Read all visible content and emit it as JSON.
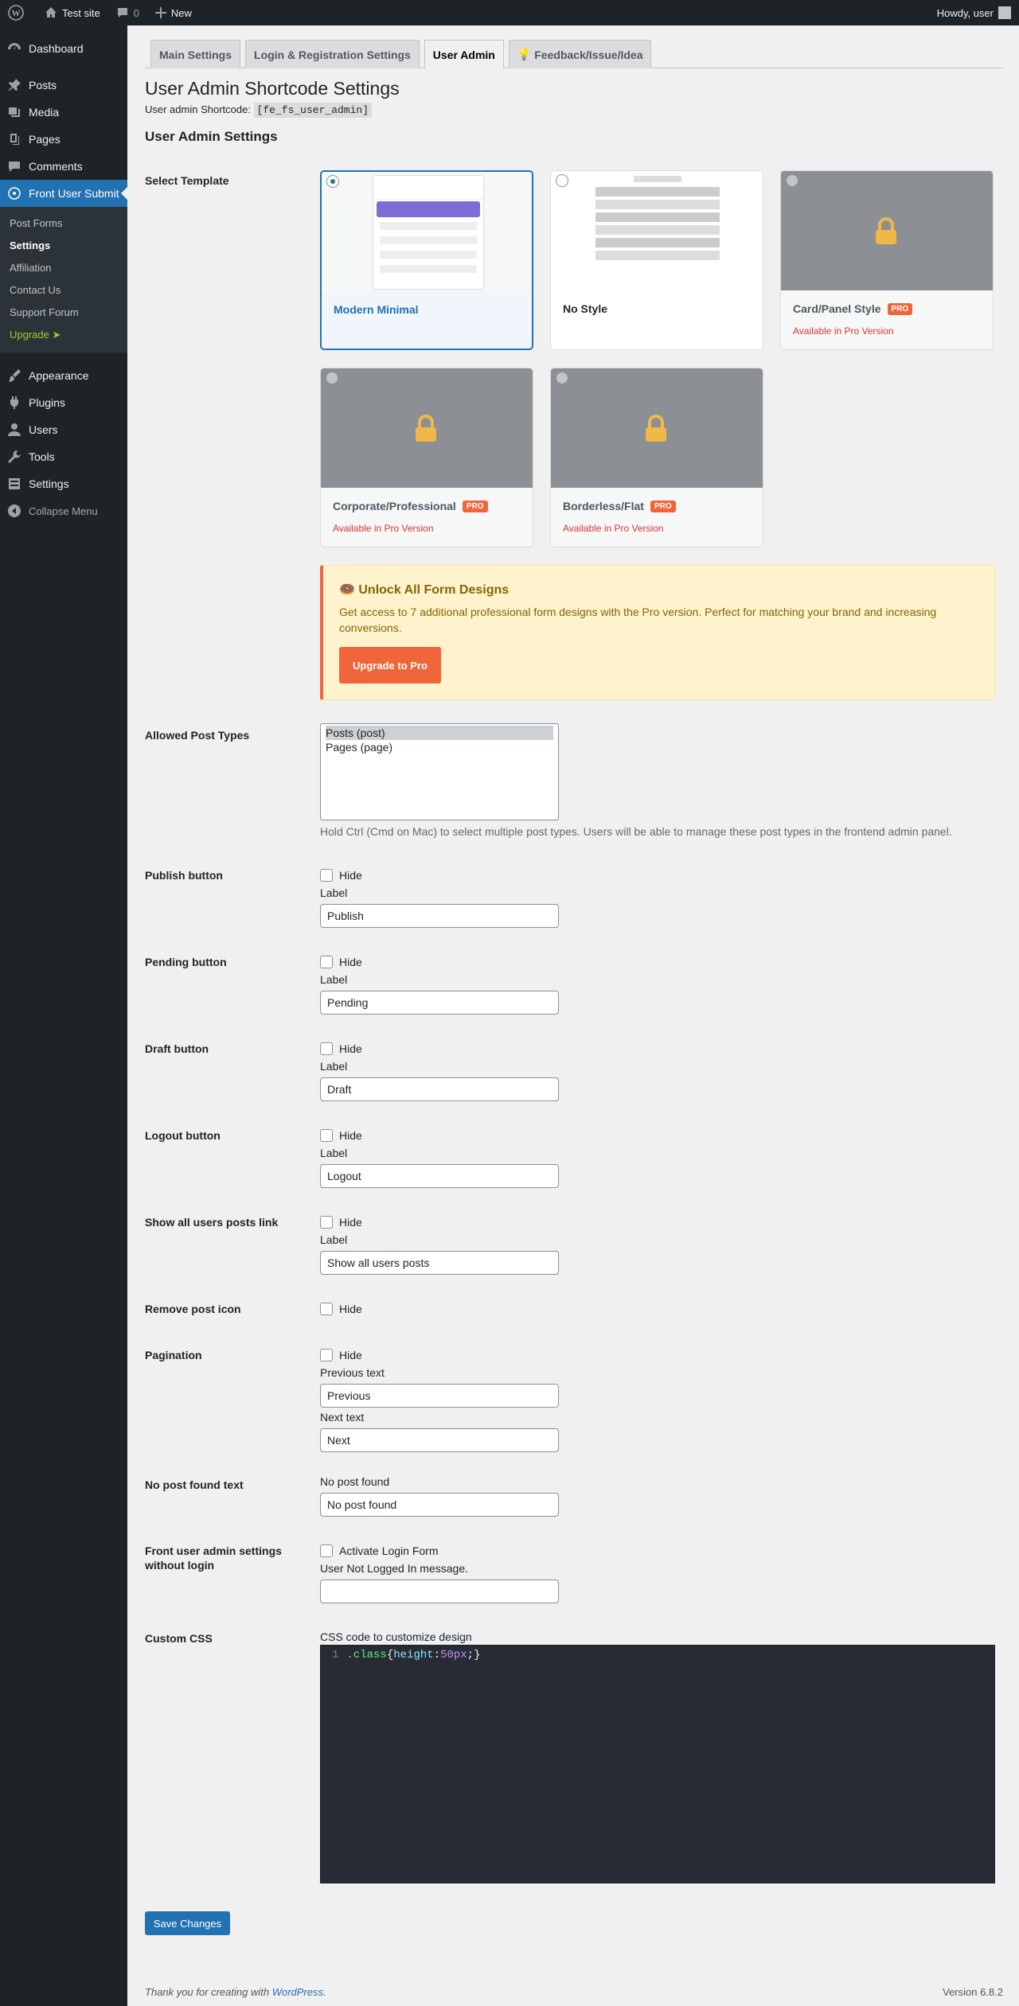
{
  "adminbar": {
    "site": "Test site",
    "comments": "0",
    "new": "New",
    "howdy": "Howdy, user"
  },
  "menu": {
    "items": [
      {
        "label": "Dashboard",
        "icon": "dashboard-icon"
      },
      {
        "label": "Posts",
        "icon": "pin-icon"
      },
      {
        "label": "Media",
        "icon": "media-icon"
      },
      {
        "label": "Pages",
        "icon": "pages-icon"
      },
      {
        "label": "Comments",
        "icon": "comment-icon"
      },
      {
        "label": "Front User Submit",
        "icon": "front-user-submit-icon"
      }
    ],
    "submenu": [
      "Post Forms",
      "Settings",
      "Affiliation",
      "Contact Us",
      "Support Forum",
      "Upgrade ➤"
    ],
    "items2": [
      {
        "label": "Appearance",
        "icon": "brush-icon"
      },
      {
        "label": "Plugins",
        "icon": "plug-icon"
      },
      {
        "label": "Users",
        "icon": "user-icon"
      },
      {
        "label": "Tools",
        "icon": "wrench-icon"
      },
      {
        "label": "Settings",
        "icon": "settings-icon"
      }
    ],
    "collapse": "Collapse Menu"
  },
  "tabs": [
    "Main Settings",
    "Login & Registration Settings",
    "User Admin",
    "Feedback/Issue/Idea"
  ],
  "page": {
    "title": "User Admin Shortcode Settings",
    "shortcode_label": "User admin Shortcode:",
    "shortcode": "[fe_fs_user_admin]",
    "section": "User Admin Settings"
  },
  "template": {
    "label": "Select Template",
    "cards": [
      {
        "name": "Modern Minimal"
      },
      {
        "name": "No Style"
      },
      {
        "name": "Card/Panel Style",
        "pro": "PRO",
        "note": "Available in Pro Version"
      },
      {
        "name": "Corporate/Professional",
        "pro": "PRO",
        "note": "Available in Pro Version"
      },
      {
        "name": "Borderless/Flat",
        "pro": "PRO",
        "note": "Available in Pro Version"
      }
    ]
  },
  "promo": {
    "title": "🍩 Unlock All Form Designs",
    "desc": "Get access to 7 additional professional form designs with the Pro version. Perfect for matching your brand and increasing conversions.",
    "button": "Upgrade to Pro"
  },
  "post_types": {
    "label": "Allowed Post Types",
    "options": [
      "Posts (post)",
      "Pages (page)"
    ],
    "help": "Hold Ctrl (Cmd on Mac) to select multiple post types. Users will be able to manage these post types in the frontend admin panel."
  },
  "buttons": [
    {
      "label": "Publish button",
      "hide": "Hide",
      "sub": "Label",
      "value": "Publish"
    },
    {
      "label": "Pending button",
      "hide": "Hide",
      "sub": "Label",
      "value": "Pending"
    },
    {
      "label": "Draft button",
      "hide": "Hide",
      "sub": "Label",
      "value": "Draft"
    },
    {
      "label": "Logout button",
      "hide": "Hide",
      "sub": "Label",
      "value": "Logout"
    },
    {
      "label": "Show all users posts link",
      "hide": "Hide",
      "sub": "Label",
      "value": "Show all users posts"
    }
  ],
  "remove_icon": {
    "label": "Remove post icon",
    "hide": "Hide"
  },
  "pagination": {
    "label": "Pagination",
    "hide": "Hide",
    "prev_label": "Previous text",
    "prev": "Previous",
    "next_label": "Next text",
    "next": "Next"
  },
  "nopost": {
    "label": "No post found text",
    "sub": "No post found",
    "value": "No post found"
  },
  "nologin": {
    "label": "Front user admin settings without login",
    "cb": "Activate Login Form",
    "sub": "User Not Logged In message.",
    "value": ""
  },
  "css": {
    "label": "Custom CSS",
    "sub": "CSS code to customize design",
    "line": "1",
    "sel": ".class",
    "prop": "height",
    "val": "50px"
  },
  "save": "Save Changes",
  "footer": {
    "thanks": "Thank you for creating with ",
    "wp": "WordPress",
    "version": "Version 6.8.2"
  }
}
